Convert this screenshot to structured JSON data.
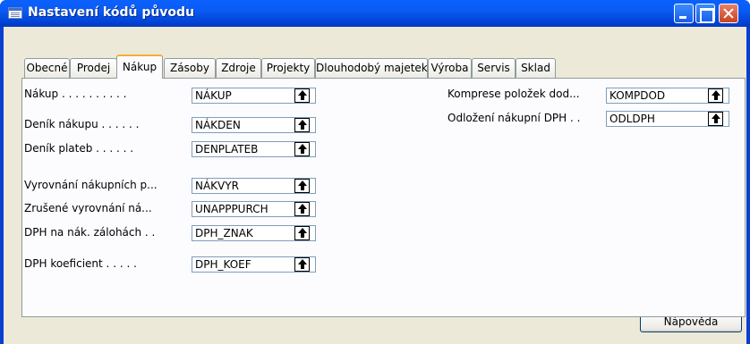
{
  "window": {
    "title": "Nastavení kódů původu"
  },
  "tabs": [
    {
      "label": "Obecné"
    },
    {
      "label": "Prodej"
    },
    {
      "label": "Nákup"
    },
    {
      "label": "Zásoby"
    },
    {
      "label": "Zdroje"
    },
    {
      "label": "Projekty"
    },
    {
      "label": "Dlouhodobý majetek"
    },
    {
      "label": "Výroba"
    },
    {
      "label": "Servis"
    },
    {
      "label": "Sklad"
    }
  ],
  "active_tab": "Nákup",
  "left_fields": [
    {
      "label": "Nákup . . . . . . . . . .",
      "value": "NÁKUP"
    },
    {
      "label": "Deník nákupu . . . . . .",
      "value": "NÁKDEN"
    },
    {
      "label": "Deník plateb . . . . . .",
      "value": "DENPLATEB"
    },
    {
      "label": "Vyrovnání nákupních p...",
      "value": "NÁKVYR"
    },
    {
      "label": "Zrušené vyrovnání ná...",
      "value": "UNAPPPURCH"
    },
    {
      "label": "DPH na nák. zálohách . .",
      "value": "DPH_ZNAK"
    },
    {
      "label": "DPH koeficient . . . . .",
      "value": "DPH_KOEF"
    }
  ],
  "right_fields": [
    {
      "label": "Komprese položek dod...",
      "value": "KOMPDOD"
    },
    {
      "label": "Odložení nákupní DPH . .",
      "value": "ODLDPH"
    }
  ],
  "buttons": {
    "help": "Nápověda"
  },
  "colors": {
    "titlebar": "#0a5bf2",
    "client": "#ece9d8",
    "active_tab_accent": "#f5ae32"
  }
}
